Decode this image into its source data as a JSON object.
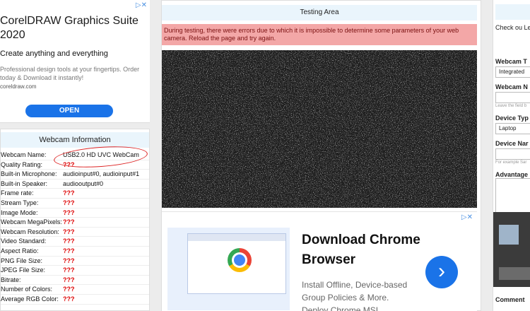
{
  "ad_top": {
    "title": "CorelDRAW Graphics Suite 2020",
    "subtitle": "Create anything and everything",
    "description": "Professional design tools at your fingertips. Order today & Download it instantly!",
    "domain": "coreldraw.com",
    "cta": "OPEN"
  },
  "webcam_info": {
    "title": "Webcam Information",
    "rows": [
      {
        "label": "Webcam Name:",
        "value": "USB2.0 HD UVC WebCam"
      },
      {
        "label": "Quality Rating:",
        "value": "???"
      },
      {
        "label": "Built-in Microphone:",
        "value": "audioinput#0, audioinput#1"
      },
      {
        "label": "Built-in Speaker:",
        "value": "audiooutput#0"
      },
      {
        "label": "Frame rate:",
        "value": "???"
      },
      {
        "label": "Stream Type:",
        "value": "???"
      },
      {
        "label": "Image Mode:",
        "value": "???"
      },
      {
        "label": "Webcam MegaPixels:",
        "value": "???"
      },
      {
        "label": "Webcam Resolution:",
        "value": "???"
      },
      {
        "label": "Video Standard:",
        "value": "???"
      },
      {
        "label": "Aspect Ratio:",
        "value": "???"
      },
      {
        "label": "PNG File Size:",
        "value": "???"
      },
      {
        "label": "JPEG File Size:",
        "value": "???"
      },
      {
        "label": "Bitrate:",
        "value": "???"
      },
      {
        "label": "Number of Colors:",
        "value": "???"
      },
      {
        "label": "Average RGB Color:",
        "value": "???"
      }
    ]
  },
  "testing": {
    "title": "Testing Area",
    "error": "During testing, there were errors due to which it is impossible to determine some parameters of your web camera. Reload the page and try again."
  },
  "ad_bottom": {
    "title": "Download Chrome Browser",
    "body": "Install Offline, Device-based Group Policies & More. Deploy Chrome MSI",
    "arrow": "›"
  },
  "right_panel": {
    "intro": "Check ou Leave a rev the place",
    "webcam_type_label": "Webcam T",
    "webcam_type_value": "Integrated",
    "webcam_name_label": "Webcam N",
    "webcam_name_hint": "Leave the field b",
    "device_type_label": "Device Typ",
    "device_type_value": "Laptop",
    "device_name_label": "Device Nar",
    "device_name_hint": "For example Sar",
    "advantages_label": "Advantage",
    "comment_label": "Comment"
  },
  "colors": {
    "accent": "#1a73e8",
    "error_bg": "#f3a7a7",
    "bad_value": "#dd0000",
    "header_bg": "#eaf5fc"
  }
}
